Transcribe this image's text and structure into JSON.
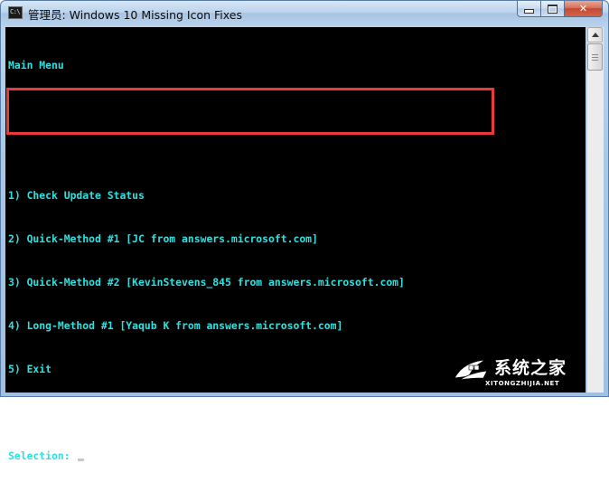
{
  "window": {
    "icon_text": "C:\\",
    "title": "管理员:  Windows 10 Missing Icon Fixes",
    "minimize_icon": "minimize-icon",
    "maximize_icon": "maximize-icon",
    "close_label": "✕"
  },
  "console": {
    "lines": [
      "Main Menu",
      "",
      "",
      "1) Check Update Status",
      "2) Quick-Method #1 [JC from answers.microsoft.com]",
      "3) Quick-Method #2 [KevinStevens_845 from answers.microsoft.com]",
      "4) Long-Method #1 [Yaqub K from answers.microsoft.com]",
      "5) Exit",
      "",
      "Selection: "
    ],
    "text_color": "#2fe0e0",
    "background": "#000000"
  },
  "annotation": {
    "color": "#e83a3a"
  },
  "watermark": {
    "chinese": "系统之家",
    "english": "XITONGZHIJIA.NET"
  }
}
